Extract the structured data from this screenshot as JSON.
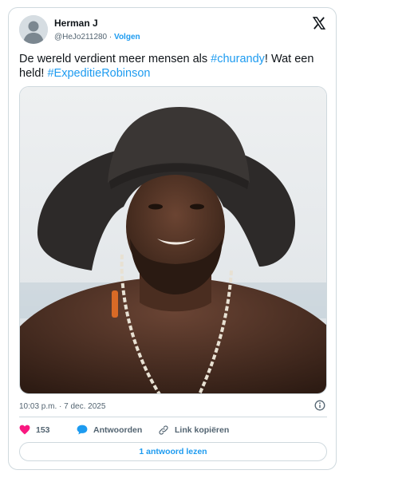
{
  "tweet": {
    "author_name": "Herman J",
    "handle": "@HeJo211280",
    "separator": " · ",
    "follow_label": "Volgen",
    "text_part1": "De wereld verdient meer mensen als ",
    "hashtag1": "#churandy",
    "text_part2": "! Wat een held! ",
    "hashtag2": "#ExpeditieRobinson",
    "timestamp": "10:03 p.m. · 7 dec. 2025"
  },
  "actions": {
    "like_count": "153",
    "reply_label": "Antwoorden",
    "copy_link_label": "Link kopiëren",
    "read_replies_label": "1 antwoord lezen"
  },
  "colors": {
    "accent": "#1d9bf0",
    "like": "#f91880",
    "muted": "#536471",
    "border": "#cfd9de"
  },
  "icons": [
    "x-logo-icon",
    "info-icon",
    "heart-icon",
    "reply-bubble-icon",
    "link-icon"
  ]
}
